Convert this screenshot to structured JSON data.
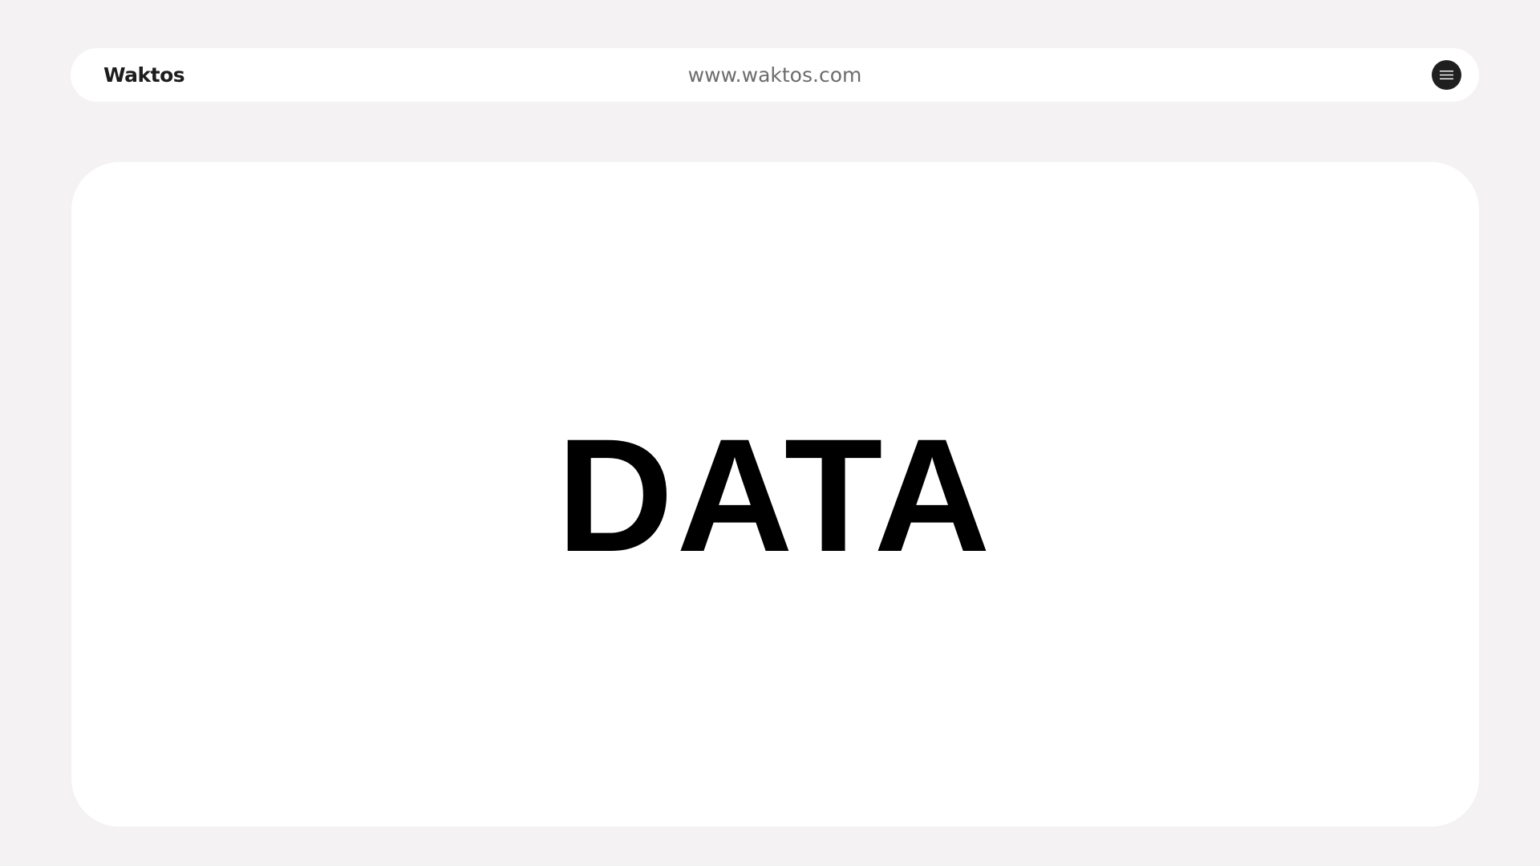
{
  "header": {
    "brand": "Waktos",
    "url": "www.waktos.com",
    "menu_icon": "hamburger-menu-icon"
  },
  "main": {
    "headline": "DATA"
  },
  "colors": {
    "page_background": "#f4f2f3",
    "surface": "#ffffff",
    "brand_text": "#1d1d1d",
    "url_text": "#6c6c6c",
    "menu_button": "#1f1f1f",
    "headline": "#000000"
  }
}
